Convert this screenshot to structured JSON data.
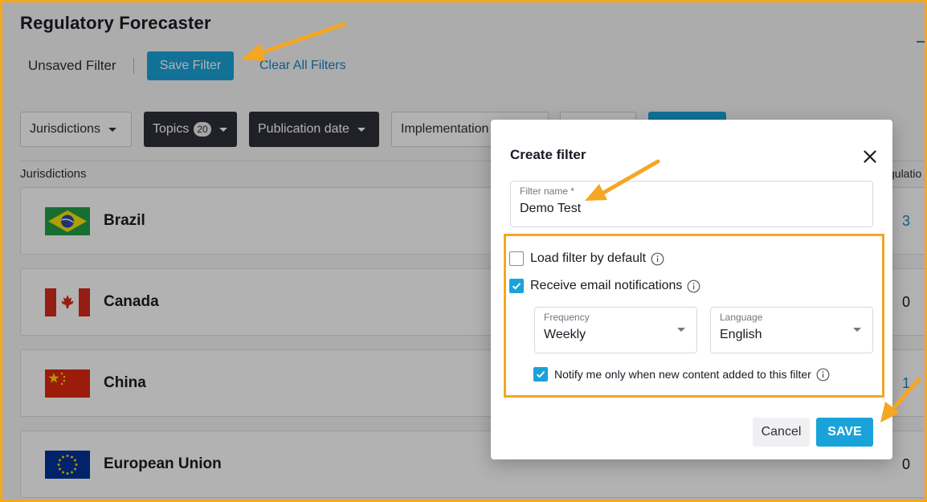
{
  "app": {
    "title": "Regulatory Forecaster"
  },
  "filter_bar": {
    "status": "Unsaved Filter",
    "save_label": "Save Filter",
    "clear_label": "Clear All Filters"
  },
  "filters": {
    "jurisdictions": "Jurisdictions",
    "topics": "Topics",
    "topics_count": "20",
    "publication_date": "Publication date",
    "implementation": "Implementation"
  },
  "table": {
    "column_jurisdictions": "Jurisdictions",
    "column_regulations_partial": "gulatio",
    "rows": [
      {
        "name": "Brazil",
        "count": "3",
        "flag": "brazil-flag"
      },
      {
        "name": "Canada",
        "count": "0",
        "flag": "canada-flag"
      },
      {
        "name": "China",
        "count": "1",
        "flag": "china-flag"
      },
      {
        "name": "European Union",
        "count": "0",
        "flag": "eu-flag"
      }
    ]
  },
  "modal": {
    "title": "Create filter",
    "filter_name_label": "Filter name *",
    "filter_name_value": "Demo Test",
    "load_default_label": "Load filter by default",
    "load_default_checked": false,
    "email_label": "Receive email notifications",
    "email_checked": true,
    "frequency_label": "Frequency",
    "frequency_value": "Weekly",
    "language_label": "Language",
    "language_value": "English",
    "notify_label": "Notify me only when new content added to this filter",
    "notify_checked": true,
    "cancel_label": "Cancel",
    "save_label": "SAVE"
  },
  "colors": {
    "accent": "#1aa3d9",
    "annotation": "#f5a623",
    "dark_chip": "#2e2e38",
    "link": "#1786bf"
  }
}
